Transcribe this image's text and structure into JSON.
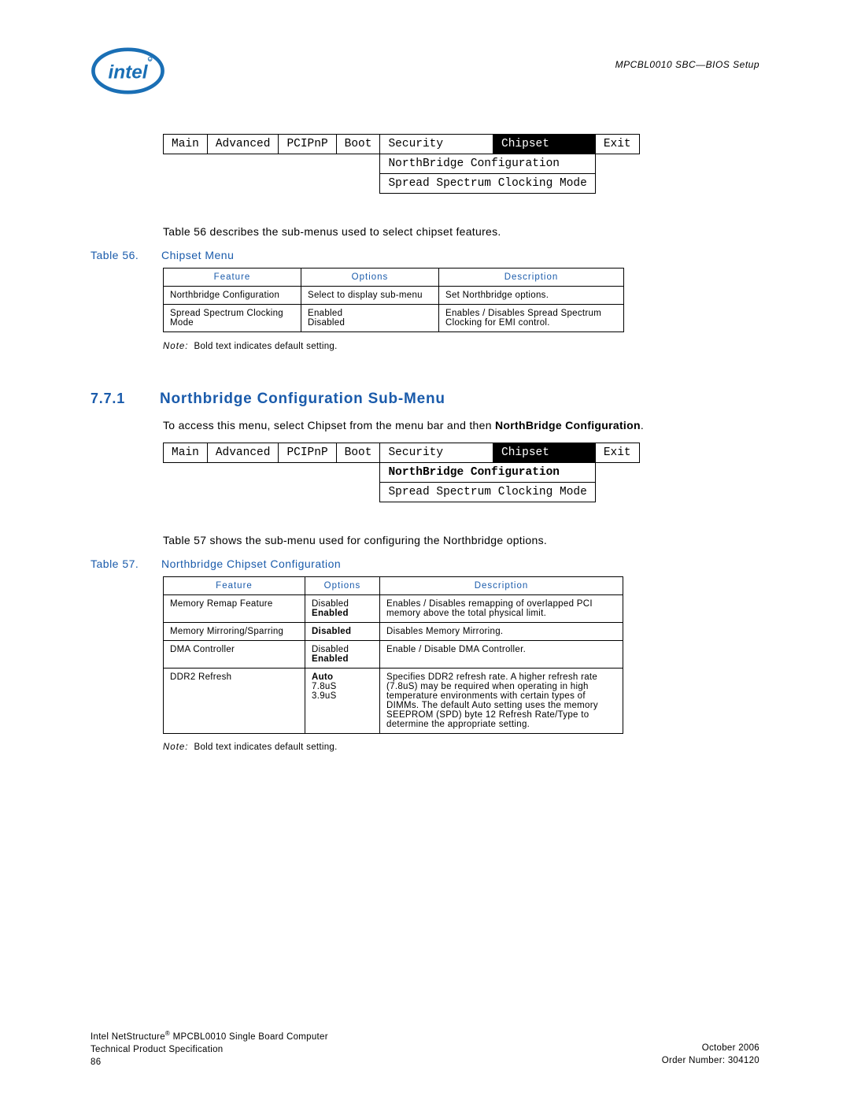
{
  "header_right": "MPCBL0010 SBC—BIOS Setup",
  "bios1": {
    "tabs": [
      "Main",
      "Advanced",
      "PCIPnP",
      "Boot",
      "Security",
      "Chipset",
      "Exit"
    ],
    "selected": "Chipset",
    "sub1": "NorthBridge Configuration",
    "sub2": "Spread Spectrum Clocking Mode"
  },
  "para1": "Table 56 describes the sub-menus used to select chipset features.",
  "table56": {
    "caption_num": "Table 56.",
    "caption_title": "Chipset Menu",
    "head": {
      "feature": "Feature",
      "options": "Options",
      "description": "Description"
    },
    "rows": [
      {
        "feature": "Northbridge Configuration",
        "options": "Select to display sub-menu",
        "description": "Set Northbridge options."
      },
      {
        "feature": "Spread Spectrum Clocking Mode",
        "options": "Enabled\nDisabled",
        "description": "Enables / Disables Spread Spectrum Clocking for EMI control."
      }
    ]
  },
  "note_label": "Note:",
  "note_text": "Bold text indicates default setting.",
  "section": {
    "num": "7.7.1",
    "title": "Northbridge Configuration Sub-Menu",
    "body_pre": "To access this menu, select Chipset from the menu bar and then ",
    "body_bold": "NorthBridge Configuration",
    "body_post": "."
  },
  "bios2": {
    "tabs": [
      "Main",
      "Advanced",
      "PCIPnP",
      "Boot",
      "Security",
      "Chipset",
      "Exit"
    ],
    "selected": "Chipset",
    "sub1": "NorthBridge Configuration",
    "sub2": "Spread Spectrum Clocking Mode"
  },
  "para2": "Table 57 shows the sub-menu used for configuring the Northbridge options.",
  "table57": {
    "caption_num": "Table 57.",
    "caption_title": "Northbridge Chipset Configuration",
    "head": {
      "feature": "Feature",
      "options": "Options",
      "description": "Description"
    },
    "rows": [
      {
        "feature": "Memory Remap Feature",
        "options_plain": "Disabled\n",
        "options_bold": "Enabled",
        "description": "Enables / Disables remapping of overlapped PCI memory above the total physical limit."
      },
      {
        "feature": "Memory Mirroring/Sparring",
        "options_plain": "",
        "options_bold": "Disabled",
        "description": "Disables Memory Mirroring."
      },
      {
        "feature": "DMA Controller",
        "options_plain": "Disabled\n",
        "options_bold": "Enabled",
        "description": "Enable / Disable DMA Controller."
      },
      {
        "feature": "DDR2 Refresh",
        "options_bold": "Auto",
        "options_plain_after": "\n7.8uS\n3.9uS",
        "description": "Specifies DDR2 refresh rate. A higher refresh rate (7.8uS) may be required when operating in high temperature environments with certain types of DIMMs. The default Auto setting uses the memory SEEPROM (SPD) byte 12 Refresh Rate/Type to determine the appropriate setting."
      }
    ]
  },
  "footer": {
    "left1_pre": "Intel NetStructure",
    "left1_post": " MPCBL0010 Single Board Computer",
    "left2": "Technical Product Specification",
    "left3": "86",
    "right1": "October 2006",
    "right2": "Order Number: 304120"
  }
}
